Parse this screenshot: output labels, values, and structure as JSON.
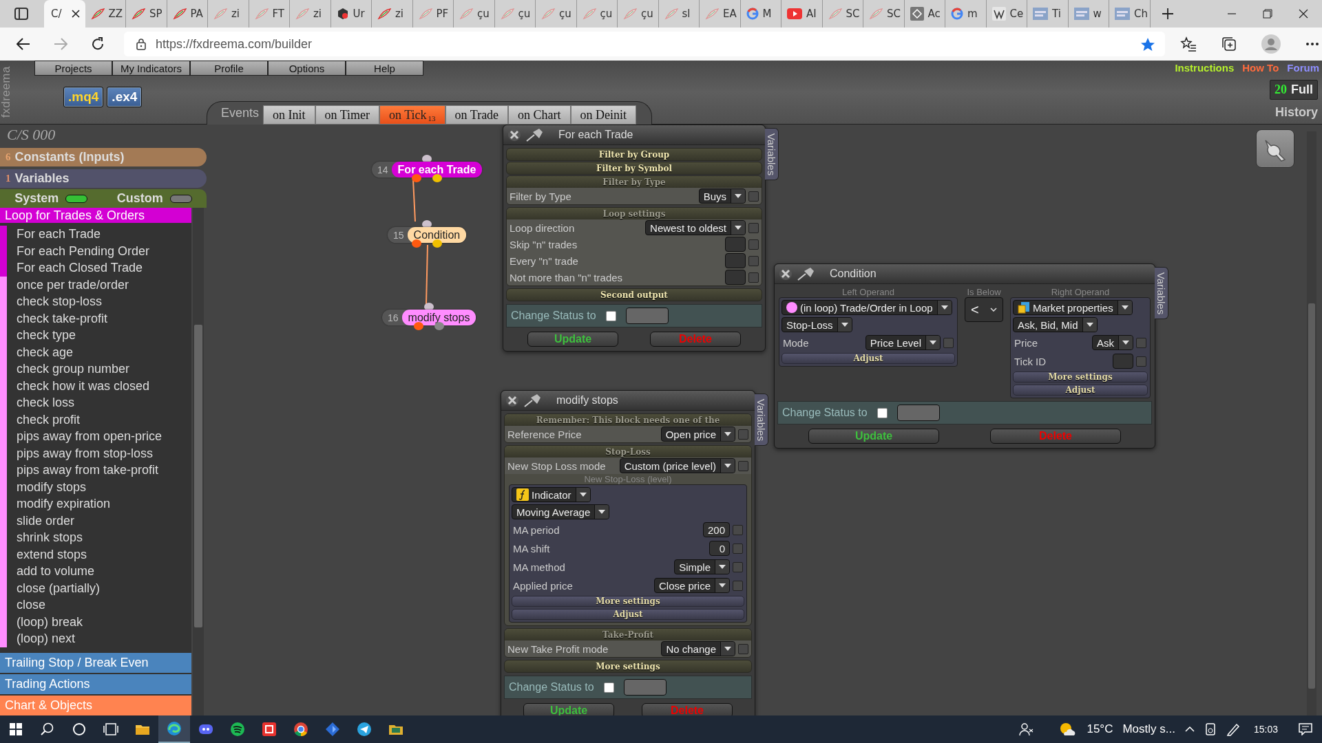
{
  "browser": {
    "tabs": [
      {
        "title": "C/",
        "selected": true,
        "kind": "blank"
      },
      {
        "title": "ZZ",
        "selected": false,
        "kind": "feather"
      },
      {
        "title": "SP",
        "selected": false,
        "kind": "feather"
      },
      {
        "title": "PA",
        "selected": false,
        "kind": "feather"
      },
      {
        "title": "zi",
        "selected": false,
        "kind": "faded"
      },
      {
        "title": "FT",
        "selected": false,
        "kind": "faded"
      },
      {
        "title": "zi",
        "selected": false,
        "kind": "faded"
      },
      {
        "title": "Ur",
        "selected": false,
        "kind": "hex"
      },
      {
        "title": "zi",
        "selected": false,
        "kind": "feather"
      },
      {
        "title": "PF",
        "selected": false,
        "kind": "faded"
      },
      {
        "title": "çu",
        "selected": false,
        "kind": "faded"
      },
      {
        "title": "çu",
        "selected": false,
        "kind": "faded"
      },
      {
        "title": "çu",
        "selected": false,
        "kind": "faded"
      },
      {
        "title": "çu",
        "selected": false,
        "kind": "faded"
      },
      {
        "title": "çu",
        "selected": false,
        "kind": "faded"
      },
      {
        "title": "sl",
        "selected": false,
        "kind": "faded"
      },
      {
        "title": "EA",
        "selected": false,
        "kind": "faded"
      },
      {
        "title": "M",
        "selected": false,
        "kind": "google"
      },
      {
        "title": "AI",
        "selected": false,
        "kind": "youtube"
      },
      {
        "title": "SC",
        "selected": false,
        "kind": "faded"
      },
      {
        "title": "SC",
        "selected": false,
        "kind": "faded"
      },
      {
        "title": "Ac",
        "selected": false,
        "kind": "code"
      },
      {
        "title": "m",
        "selected": false,
        "kind": "google"
      },
      {
        "title": "Ce",
        "selected": false,
        "kind": "wiki"
      },
      {
        "title": "Ti",
        "selected": false,
        "kind": "mql"
      },
      {
        "title": "w",
        "selected": false,
        "kind": "mql"
      },
      {
        "title": "Ch",
        "selected": false,
        "kind": "mql"
      }
    ],
    "address": "https://fxdreema.com/builder"
  },
  "app": {
    "logo": "fxdreema",
    "menu": [
      "Projects",
      "My Indicators",
      "Profile",
      "Options",
      "Help"
    ],
    "links": [
      {
        "label": "Instructions",
        "color": "#b6f12c"
      },
      {
        "label": "How To",
        "color": "#ff6b3d"
      },
      {
        "label": "Forum",
        "color": "#8f8fff"
      }
    ],
    "compile_buttons": [
      {
        "label": ".mq4",
        "kind": "mq4"
      },
      {
        "label": ".ex4",
        "kind": "ex4"
      }
    ],
    "history": {
      "count": "20",
      "mode": "Full",
      "label": "History"
    },
    "events": {
      "label": "Events",
      "tabs": [
        {
          "label": "on Init",
          "selected": false
        },
        {
          "label": "on Timer",
          "selected": false
        },
        {
          "label": "on Tick",
          "selected": true,
          "badge": "13"
        },
        {
          "label": "on Trade",
          "selected": false
        },
        {
          "label": "on Chart",
          "selected": false
        },
        {
          "label": "on Deinit",
          "selected": false
        }
      ]
    }
  },
  "sidebar": {
    "project": "C/S 000",
    "constants": {
      "count": "6",
      "label": "Constants (Inputs)"
    },
    "variables": {
      "count": "1",
      "label": "Variables"
    },
    "toggles": [
      {
        "label": "System",
        "on": true
      },
      {
        "label": "Custom",
        "on": false
      }
    ],
    "categories": [
      {
        "label": "Loop for Trades & Orders",
        "color": "#d300d3",
        "expanded": true,
        "items": [
          {
            "label": "For each Trade",
            "kind": "loop"
          },
          {
            "label": "For each Pending Order",
            "kind": "loop"
          },
          {
            "label": "For each Closed Trade",
            "kind": "loop"
          },
          {
            "label": "once per trade/order",
            "kind": "block"
          },
          {
            "label": "check stop-loss",
            "kind": "block"
          },
          {
            "label": "check take-profit",
            "kind": "block"
          },
          {
            "label": "check type",
            "kind": "block"
          },
          {
            "label": "check age",
            "kind": "block"
          },
          {
            "label": "check group number",
            "kind": "block"
          },
          {
            "label": "check how it was closed",
            "kind": "block"
          },
          {
            "label": "check loss",
            "kind": "block"
          },
          {
            "label": "check profit",
            "kind": "block"
          },
          {
            "label": "pips away from open-price",
            "kind": "block"
          },
          {
            "label": "pips away from stop-loss",
            "kind": "block"
          },
          {
            "label": "pips away from take-profit",
            "kind": "block"
          },
          {
            "label": "modify stops",
            "kind": "block"
          },
          {
            "label": "modify expiration",
            "kind": "block"
          },
          {
            "label": "slide order",
            "kind": "block"
          },
          {
            "label": "shrink stops",
            "kind": "block"
          },
          {
            "label": "extend stops",
            "kind": "block"
          },
          {
            "label": "add to volume",
            "kind": "block"
          },
          {
            "label": "close (partially)",
            "kind": "block"
          },
          {
            "label": "close",
            "kind": "block"
          },
          {
            "label": "(loop) break",
            "kind": "block"
          },
          {
            "label": "(loop) next",
            "kind": "block"
          }
        ]
      },
      {
        "label": "Trailing Stop / Break Even",
        "color": "#4a84bd",
        "expanded": false
      },
      {
        "label": "Trading Actions",
        "color": "#4a84bd",
        "expanded": false
      },
      {
        "label": "Chart & Objects",
        "color": "#ff8350",
        "expanded": false
      }
    ]
  },
  "nodes": [
    {
      "number": "14",
      "label": "For each Trade",
      "color": "#d600d6"
    },
    {
      "number": "15",
      "label": "Condition",
      "color": "#ffd9a3"
    },
    {
      "number": "16",
      "label": "modify stops",
      "color": "#ff8cff"
    }
  ],
  "panels": [
    {
      "title": "For each Trade",
      "side_tab": "Variables",
      "rows": [
        {
          "kind": "section",
          "label": "Filter by Group",
          "expanded": false
        },
        {
          "kind": "section",
          "label": "Filter by Symbol",
          "expanded": false
        },
        {
          "kind": "section",
          "label": "Filter by Type",
          "expanded": true
        },
        {
          "kind": "select",
          "label": "Filter by Type",
          "value": "Buys",
          "checked": false
        },
        {
          "kind": "section",
          "label": "Loop settings",
          "expanded": true
        },
        {
          "kind": "select",
          "label": "Loop direction",
          "value": "Newest to oldest",
          "checked": false
        },
        {
          "kind": "number",
          "label": "Skip \"n\" trades",
          "checked": false
        },
        {
          "kind": "number",
          "label": "Every \"n\" trade",
          "checked": false
        },
        {
          "kind": "number",
          "label": "Not more than \"n\" trades",
          "checked": false
        },
        {
          "kind": "section",
          "label": "Second output",
          "expanded": false
        }
      ],
      "status": {
        "label": "Change Status to",
        "checked": false
      },
      "buttons": [
        {
          "label": "Update",
          "kind": "update"
        },
        {
          "label": "Delete",
          "kind": "delete"
        }
      ]
    },
    {
      "title": "Condition",
      "side_tab": "Variables",
      "operands": {
        "left": {
          "caption": "Left Operand",
          "source": {
            "kind": "dot",
            "value": "(in loop) Trade/Order in Loop"
          },
          "selects": [
            "Stop-Loss"
          ],
          "rows": [
            {
              "kind": "select",
              "label": "Mode",
              "value": "Price Level",
              "checked": false
            }
          ],
          "buttons": [
            "Adjust"
          ]
        },
        "middle": {
          "caption": "Is Below",
          "value": "<"
        },
        "right": {
          "caption": "Right Operand",
          "source": {
            "kind": "market",
            "value": "Market properties"
          },
          "selects": [
            "Ask, Bid, Mid"
          ],
          "rows": [
            {
              "kind": "select",
              "label": "Price",
              "value": "Ask",
              "checked": false
            },
            {
              "kind": "number",
              "label": "Tick ID",
              "checked": false
            }
          ],
          "buttons": [
            "More settings",
            "Adjust"
          ]
        }
      },
      "status": {
        "label": "Change Status to",
        "checked": false
      },
      "buttons": [
        {
          "label": "Update",
          "kind": "update"
        },
        {
          "label": "Delete",
          "kind": "delete"
        }
      ]
    },
    {
      "title": "modify stops",
      "side_tab": "Variables",
      "rows": [
        {
          "kind": "section",
          "label": "Remember: This block needs one of the",
          "expanded": true
        },
        {
          "kind": "select",
          "label": "Reference Price",
          "value": "Open price",
          "checked": false
        },
        {
          "kind": "section",
          "label": "Stop-Loss",
          "expanded": true
        },
        {
          "kind": "select",
          "label": "New Stop Loss mode",
          "value": "Custom (price level)",
          "checked": false
        },
        {
          "kind": "caption",
          "label": "New Stop-Loss (level)"
        },
        {
          "kind": "operand",
          "source": {
            "kind": "function",
            "value": "Indicator"
          },
          "selects": [
            "Moving Average"
          ],
          "rows": [
            {
              "kind": "number",
              "label": "MA period",
              "value": "200",
              "checked": false
            },
            {
              "kind": "number",
              "label": "MA shift",
              "value": "0",
              "checked": false
            },
            {
              "kind": "select",
              "label": "MA method",
              "value": "Simple",
              "checked": false
            },
            {
              "kind": "select",
              "label": "Applied price",
              "value": "Close price",
              "checked": false
            }
          ],
          "buttons": [
            "More settings",
            "Adjust"
          ]
        },
        {
          "kind": "section",
          "label": "Take-Profit",
          "expanded": true
        },
        {
          "kind": "select",
          "label": "New Take Profit mode",
          "value": "No change",
          "checked": false
        },
        {
          "kind": "section",
          "label": "More settings",
          "expanded": false
        }
      ],
      "status": {
        "label": "Change Status to",
        "checked": false
      },
      "buttons": [
        {
          "label": "Update",
          "kind": "update"
        },
        {
          "label": "Delete",
          "kind": "delete"
        }
      ]
    }
  ],
  "taskbar": {
    "apps": [
      {
        "kind": "explorer",
        "active": false
      },
      {
        "kind": "edge",
        "active": true
      },
      {
        "kind": "discord",
        "active": false
      },
      {
        "kind": "spotify",
        "active": false
      },
      {
        "kind": "ig",
        "active": false
      },
      {
        "kind": "chrome",
        "active": false
      },
      {
        "kind": "diamond",
        "active": false
      },
      {
        "kind": "telegram",
        "active": false
      },
      {
        "kind": "folder",
        "active": false
      }
    ],
    "temperature": "15°C",
    "weather": "Mostly s...",
    "time": "15:03"
  }
}
